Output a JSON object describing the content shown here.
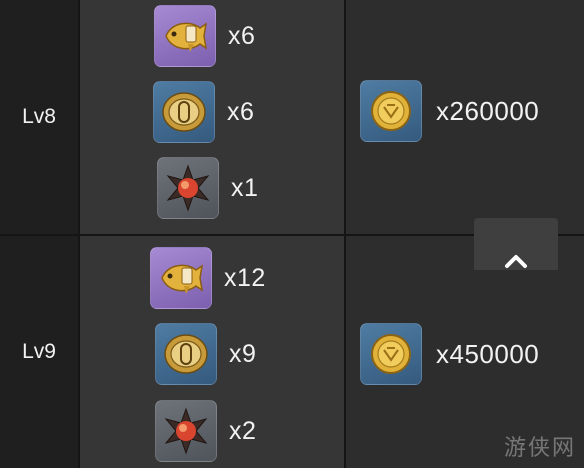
{
  "rows": [
    {
      "level": "Lv8",
      "materials": [
        {
          "icon": "golden-fish-icon",
          "rarity": "purple",
          "qty": "x6"
        },
        {
          "icon": "gold-ring-emblem-icon",
          "rarity": "blue",
          "qty": "x6"
        },
        {
          "icon": "red-star-crystal-icon",
          "rarity": "gray",
          "qty": "x1"
        }
      ],
      "cost": {
        "icon": "coin-icon",
        "qty": "x260000"
      }
    },
    {
      "level": "Lv9",
      "materials": [
        {
          "icon": "golden-fish-icon",
          "rarity": "purple",
          "qty": "x12"
        },
        {
          "icon": "gold-ring-emblem-icon",
          "rarity": "blue",
          "qty": "x9"
        },
        {
          "icon": "red-star-crystal-icon",
          "rarity": "gray",
          "qty": "x2"
        }
      ],
      "cost": {
        "icon": "coin-icon",
        "qty": "x450000"
      }
    }
  ],
  "scroll_top": {
    "icon": "chevron-up-icon"
  },
  "watermark": "游侠网",
  "colors": {
    "purple": "#8f72c2",
    "blue": "#43698f",
    "gray": "#5f6469",
    "gold": "#e0b23a"
  }
}
